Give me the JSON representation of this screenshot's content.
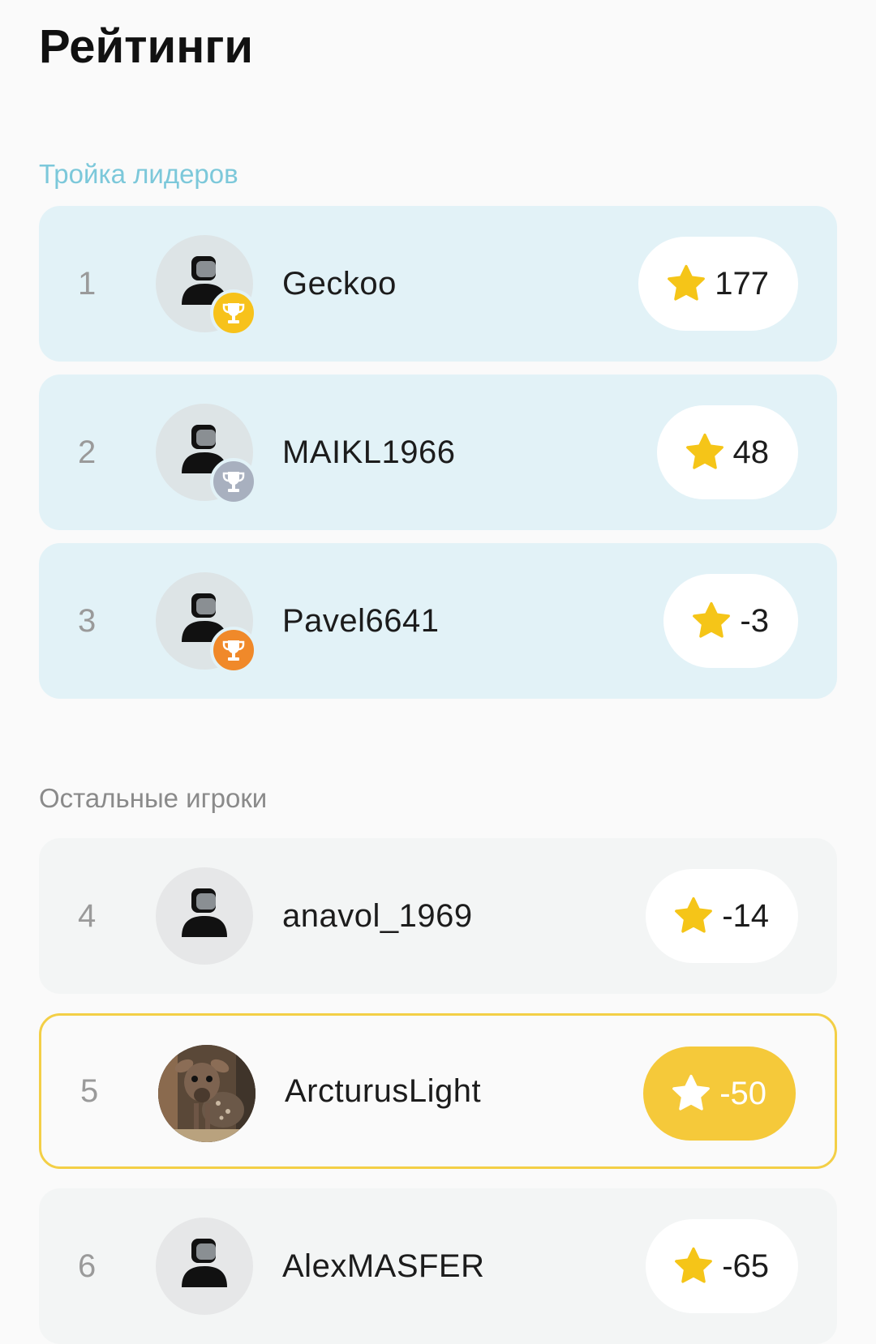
{
  "page": {
    "title": "Рейтинги"
  },
  "sections": {
    "leaders_label": "Тройка лидеров",
    "others_label": "Остальные игроки"
  },
  "leaders": [
    {
      "rank": "1",
      "name": "Geckoo",
      "score": "177",
      "trophy": "gold"
    },
    {
      "rank": "2",
      "name": "MAIKL1966",
      "score": "48",
      "trophy": "silver"
    },
    {
      "rank": "3",
      "name": "Pavel6641",
      "score": "-3",
      "trophy": "bronze"
    }
  ],
  "others": [
    {
      "rank": "4",
      "name": "anavol_1969",
      "score": "-14"
    },
    {
      "rank": "5",
      "name": "ArcturusLight",
      "score": "-50",
      "current_user": true
    },
    {
      "rank": "6",
      "name": "AlexMASFER",
      "score": "-65"
    }
  ],
  "icons": {
    "avatar": "person-icon",
    "trophy": "trophy-icon",
    "score": "star-icon"
  },
  "colors": {
    "star": "#f5c518",
    "highlight": "#f5c93a",
    "leaders_label": "#7cc8da",
    "trophy_gold": "#f7c21b",
    "trophy_silver": "#a8b0bf",
    "trophy_bronze": "#f0892a"
  }
}
